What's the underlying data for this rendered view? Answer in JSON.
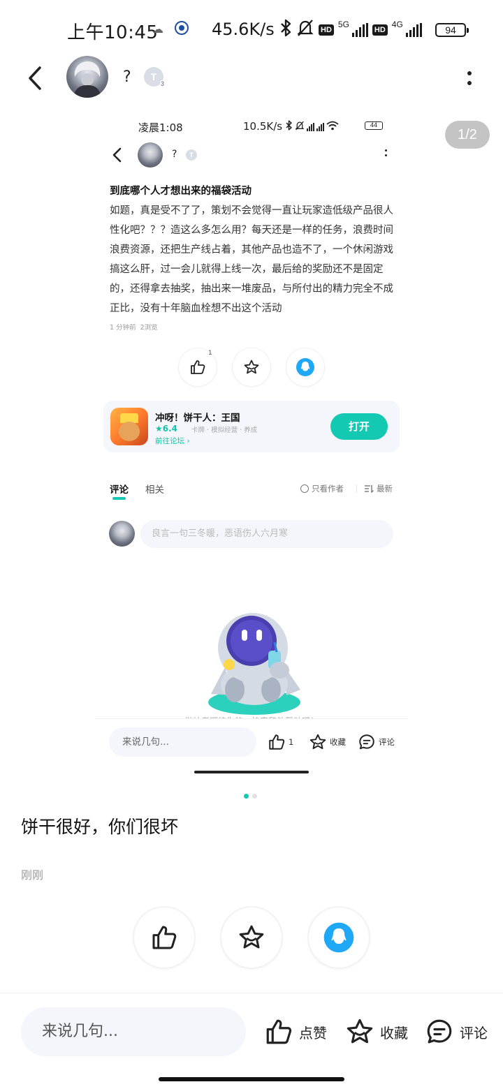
{
  "status_bar": {
    "time": "上午10:45",
    "net_speed": "45.6K/s",
    "hd_label": "HD",
    "net_5g": "5G",
    "net_4g": "4G",
    "battery": "94"
  },
  "header": {
    "username": "?",
    "level_badge": "T",
    "level_sub": "3"
  },
  "page_indicator": "1/2",
  "screenshot": {
    "status_bar": {
      "time": "凌晨1:08",
      "net_speed": "10.5K/s",
      "hd_label": "HD",
      "battery": "44"
    },
    "header": {
      "username": "?",
      "level_badge": "T"
    },
    "post": {
      "title": "到底哪个人才想出来的福袋活动",
      "body": "如题，真是受不了了，策划不会觉得一直让玩家造低级产品很人性化吧？？？造这么多怎么用？每天还是一样的任务，浪费时间浪费资源，还把生产线占着，其他产品也造不了，一个休闲游戏搞这么肝，过一会儿就得上线一次，最后给的奖励还不是固定的，还得拿去抽奖，抽出来一堆废品，与所付出的精力完全不成正比，没有十年脑血栓想不出这个活动",
      "time_ago": "1 分钟前",
      "views": "2浏览",
      "like_count": "1"
    },
    "game_card": {
      "name": "冲呀！饼干人：王国",
      "rating": "6.4",
      "tags": [
        "卡牌",
        "模拟经营",
        "养成"
      ],
      "forum_link": "前往论坛",
      "open_button": "打开"
    },
    "tabs": {
      "comments": "评论",
      "related": "相关",
      "author_only": "只看作者",
      "latest": "最新"
    },
    "comment_placeholder": "良言一句三冬暖，恶语伤人六月寒",
    "empty_tip": "发帖者期待你的一技来和他互动吧！",
    "bottom_bar": {
      "say_placeholder": "来说几句...",
      "like_count": "1",
      "favorite": "收藏",
      "comment": "评论"
    }
  },
  "post": {
    "title": "饼干很好，你们很坏",
    "time": "刚刚"
  },
  "bottom_bar": {
    "say_placeholder": "来说几句...",
    "like": "点赞",
    "favorite": "收藏",
    "comment": "评论"
  },
  "colors": {
    "accent": "#14c9b1",
    "qq_blue": "#1fa8f5"
  }
}
